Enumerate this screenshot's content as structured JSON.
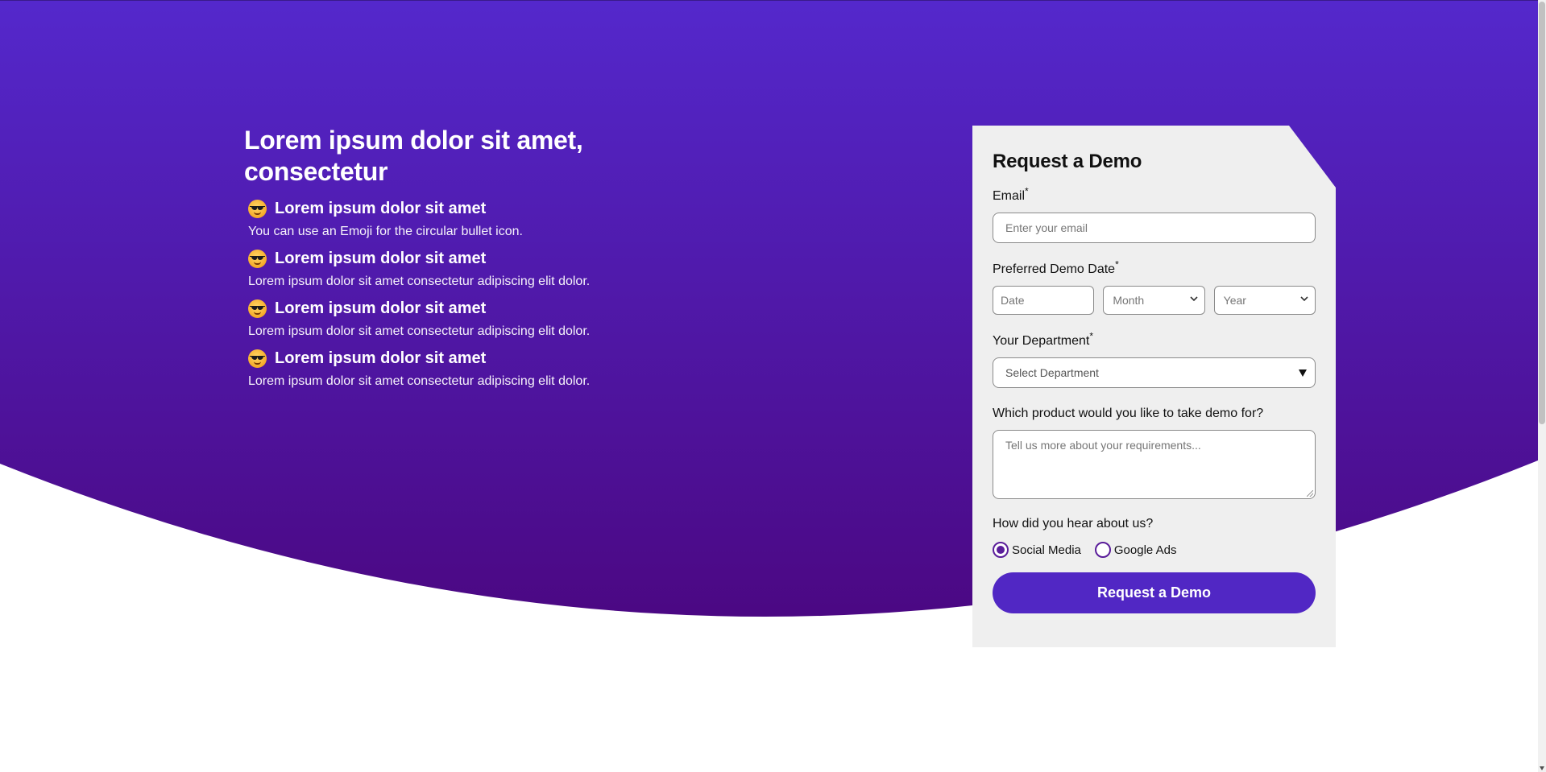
{
  "colors": {
    "hero_top": "#5428cc",
    "hero_bottom": "#4b0883",
    "card_bg": "#efefef",
    "button_bg": "#5127c4",
    "radio_accent": "#5a1d9a"
  },
  "hero": {
    "headline": "Lorem ipsum dolor sit amet, consectetur",
    "features": [
      {
        "icon": "smiling-face-with-sunglasses-emoji",
        "title": "Lorem ipsum dolor sit amet",
        "desc": "You can use an Emoji for the circular bullet icon."
      },
      {
        "icon": "smiling-face-with-sunglasses-emoji",
        "title": "Lorem ipsum dolor sit amet",
        "desc": "Lorem ipsum dolor sit amet consectetur adipiscing elit dolor."
      },
      {
        "icon": "smiling-face-with-sunglasses-emoji",
        "title": "Lorem ipsum dolor sit amet",
        "desc": "Lorem ipsum dolor sit amet consectetur adipiscing elit dolor."
      },
      {
        "icon": "smiling-face-with-sunglasses-emoji",
        "title": "Lorem ipsum dolor sit amet",
        "desc": "Lorem ipsum dolor sit amet consectetur adipiscing elit dolor."
      }
    ]
  },
  "form": {
    "title": "Request a Demo",
    "email": {
      "label": "Email",
      "required_mark": "*",
      "placeholder": "Enter your email",
      "value": ""
    },
    "demo_date": {
      "label": "Preferred Demo Date",
      "required_mark": "*",
      "date_placeholder": "Date",
      "month_selected": "Month",
      "year_selected": "Year"
    },
    "department": {
      "label": "Your Department",
      "required_mark": "*",
      "selected": "Select Department"
    },
    "product": {
      "label": "Which product would you like to take demo for?",
      "placeholder": "Tell us more about your requirements..."
    },
    "hear": {
      "label": "How did you hear about us?",
      "options": [
        {
          "label": "Social Media",
          "checked": true
        },
        {
          "label": "Google Ads",
          "checked": false
        }
      ]
    },
    "submit_label": "Request a Demo"
  }
}
